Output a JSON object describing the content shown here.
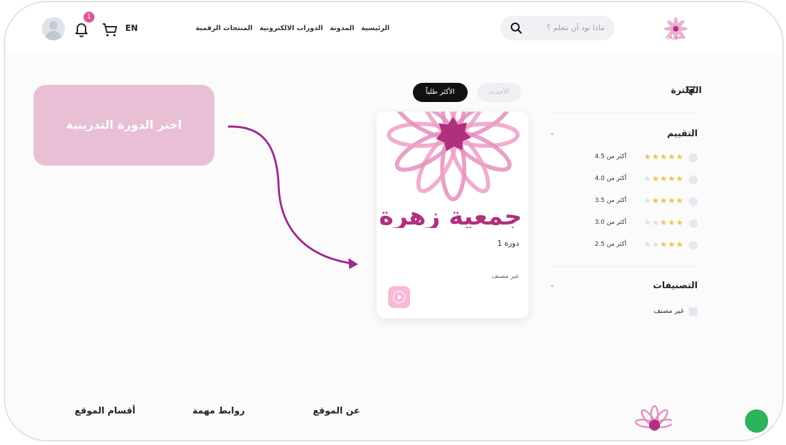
{
  "header": {
    "lang": "EN",
    "notification_count": "1",
    "nav": [
      "الرئيسية",
      "المدونة",
      "الدورات الالكترونية",
      "المنتجات الرقمية"
    ],
    "search_placeholder": "ماذا تود أن تتعلم ؟",
    "logo_text": "جمعية زهرة"
  },
  "filter": {
    "title": "الفلترة",
    "rating_title": "التقييم",
    "ratings": [
      {
        "label": "أكثر من 4.5",
        "stars": 5
      },
      {
        "label": "أكثر من 4.0",
        "stars": 4
      },
      {
        "label": "أكثر من 3.5",
        "stars": 4
      },
      {
        "label": "أكثر من 3.0",
        "stars": 3
      },
      {
        "label": "أكثر من 2.5",
        "stars": 3
      }
    ],
    "categories_title": "التصنيفات",
    "categories": [
      "غير مصنف"
    ]
  },
  "sort": {
    "newest": "الأحدث",
    "most_popular": "الأكثر طلباً"
  },
  "course": {
    "title": "دورة 1",
    "category": "غير مصنف",
    "brand_text": "جمعية زهرة"
  },
  "callout": {
    "text": "اختر الدورة التدريبية"
  },
  "footer": {
    "site_sections": "أقسام الموقع",
    "important_links": "روابط مهمة",
    "about": "عن الموقع"
  },
  "colors": {
    "accent": "#b0307e",
    "callout": "#e8bfd4",
    "star": "#f2c14e",
    "star_empty": "#dcdfe5"
  }
}
